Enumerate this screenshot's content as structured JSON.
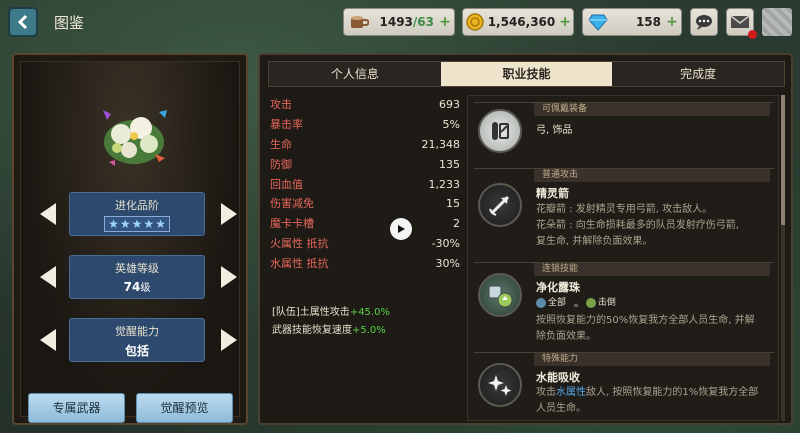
{
  "header": {
    "title": "图鉴",
    "stamina": {
      "current": "1493",
      "max": "/63"
    },
    "gold": "1,546,360",
    "gems": "158"
  },
  "hero_panel": {
    "evolution": {
      "label": "进化品阶",
      "stars": 5
    },
    "level": {
      "label": "英雄等级",
      "value": "74",
      "unit": "级"
    },
    "awakening": {
      "label": "觉醒能力",
      "value": "包括"
    },
    "buttons": {
      "weapon": "专属武器",
      "awaken_preview": "觉醒预览"
    }
  },
  "tabs": [
    {
      "label": "个人信息",
      "active": false
    },
    {
      "label": "职业技能",
      "active": true
    },
    {
      "label": "完成度",
      "active": false
    }
  ],
  "stats": [
    {
      "label": "攻击",
      "value": "693"
    },
    {
      "label": "暴击率",
      "value": "5%"
    },
    {
      "label": "生命",
      "value": "21,348"
    },
    {
      "label": "防御",
      "value": "135"
    },
    {
      "label": "回血值",
      "value": "1,233"
    },
    {
      "label": "伤害减免",
      "value": "15"
    },
    {
      "label": "魔卡卡槽",
      "value": "2"
    },
    {
      "label": "火属性 抵抗",
      "value": "-30%"
    },
    {
      "label": "水属性 抵抗",
      "value": "30%"
    }
  ],
  "bonuses": [
    {
      "text": "[队伍]土属性攻击",
      "plus": "+45.0%"
    },
    {
      "text": "武器技能恢复速度",
      "plus": "+5.0%"
    }
  ],
  "skills": {
    "equip": {
      "category": "可佩戴装备",
      "text": "弓, 饰品"
    },
    "normal": {
      "category": "普通攻击",
      "name": "精灵箭",
      "line1": "花瓣箭 : 发射精灵专用弓箭, 攻击敌人。",
      "line2": "花朵箭 : 向生命损耗最多的队员发射疗伤弓箭,",
      "line3": "复生命, 并解除负面效果。"
    },
    "chain": {
      "category": "连锁技能",
      "name": "净化露珠",
      "tag_from": "全部",
      "tag_to": "击倒",
      "line1": "按照恢复能力的50%恢复我方全部人员生命, 并解",
      "line2": "除负面效果。"
    },
    "special": {
      "category": "特殊能力",
      "name": "水能吸收",
      "pre": "攻击",
      "highlight": "水属性",
      "post": "敌人, 按照恢复能力的1%恢复我方全部",
      "line2": "人员生命。"
    }
  },
  "colors": {
    "accent_tab": "#eee4cc",
    "stat_label": "#e5685a",
    "bonus_plus": "#5bd046",
    "highlight": "#55a9e6"
  }
}
